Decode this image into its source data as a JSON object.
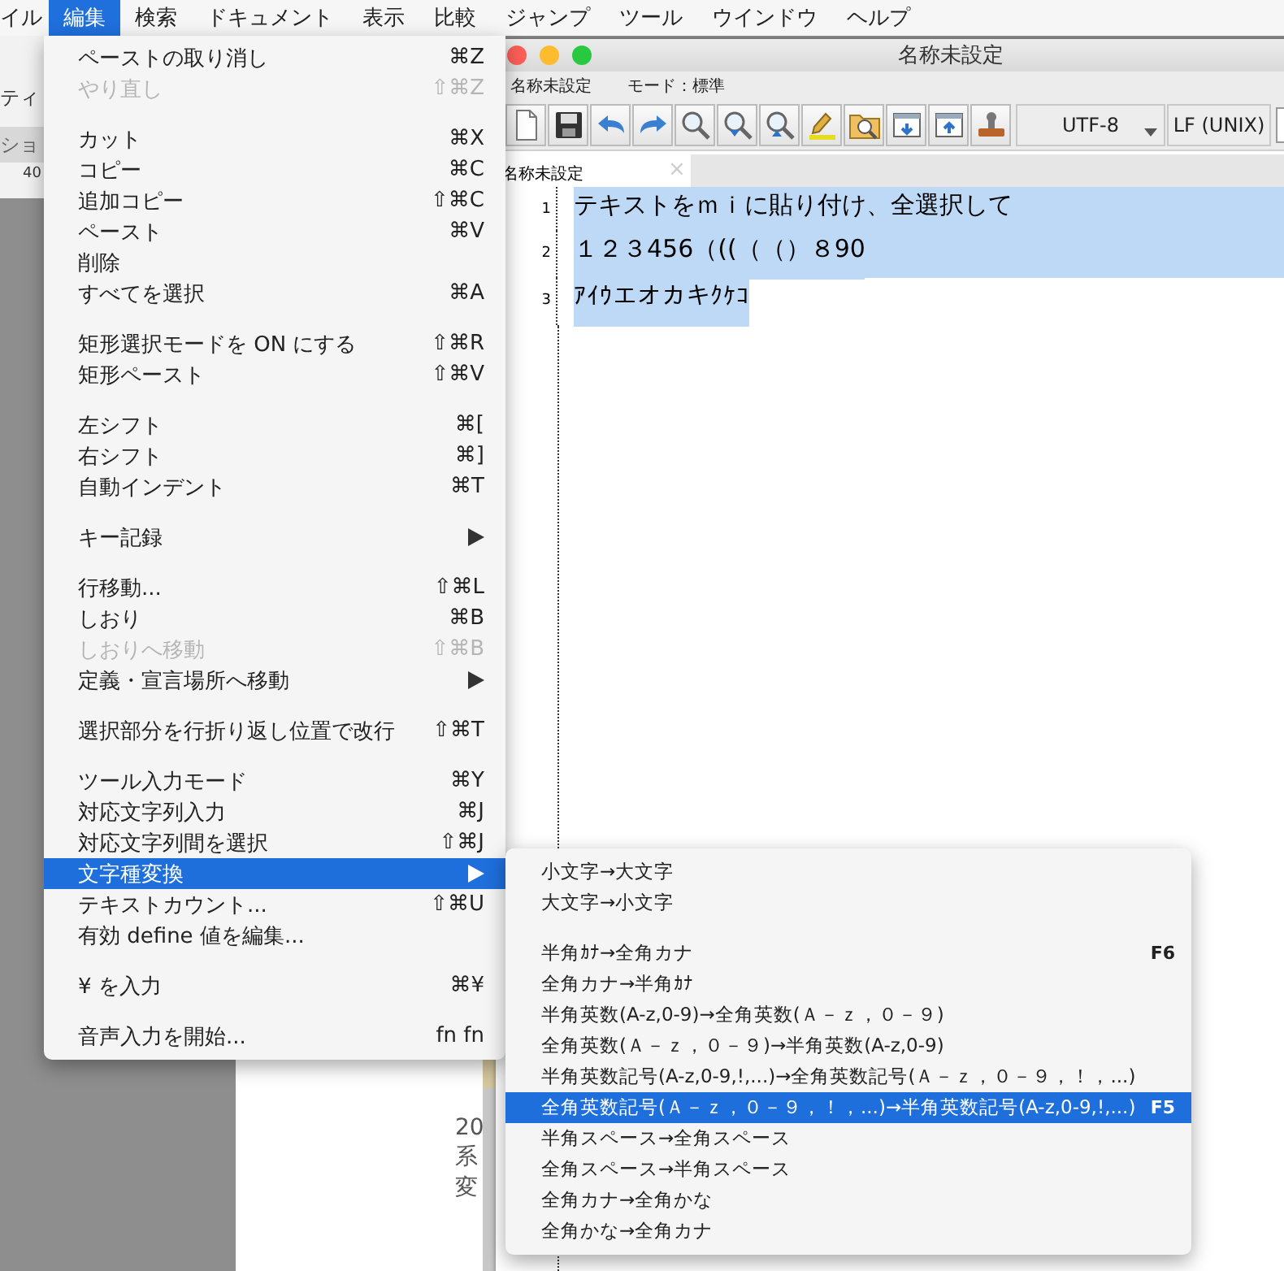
{
  "menubar": {
    "items": [
      {
        "label": "イル",
        "selected": false
      },
      {
        "label": "編集",
        "selected": true
      },
      {
        "label": "検索",
        "selected": false
      },
      {
        "label": "ドキュメント",
        "selected": false
      },
      {
        "label": "表示",
        "selected": false
      },
      {
        "label": "比較",
        "selected": false
      },
      {
        "label": "ジャンプ",
        "selected": false
      },
      {
        "label": "ツール",
        "selected": false
      },
      {
        "label": "ウインドウ",
        "selected": false
      },
      {
        "label": "ヘルプ",
        "selected": false
      }
    ]
  },
  "background_windows": {
    "left_texts": [
      "ティ",
      "ショ",
      "40"
    ],
    "middle_texts": [
      "20",
      "系",
      "変"
    ]
  },
  "editor_window": {
    "title": "名称未設定",
    "document_name": "名称未設定",
    "mode": "モード：標準",
    "encoding": "UTF-8",
    "line_ending": "LF (UNIX)",
    "tab": {
      "label": "名称未設定",
      "close": "×",
      "selected": true
    },
    "lines": [
      {
        "number": "1",
        "text": "テキストをｍｉに貼り付け、全選択して",
        "selected": true,
        "newline_selected": true
      },
      {
        "number": "2",
        "text": "１２３456（((（（）８90",
        "selected": true,
        "newline_selected": true
      },
      {
        "number": "3",
        "text": "ｱｲｳエオカキｸｹｺ",
        "selected": true,
        "newline_selected": false
      }
    ]
  },
  "edit_menu": {
    "items": [
      {
        "kind": "item",
        "label": "ペーストの取り消し",
        "shortcut": "⌘Z",
        "disabled": false,
        "selected": false,
        "submenu": false
      },
      {
        "kind": "item",
        "label": "やり直し",
        "shortcut": "⇧⌘Z",
        "disabled": true,
        "selected": false,
        "submenu": false
      },
      {
        "kind": "separator"
      },
      {
        "kind": "item",
        "label": "カット",
        "shortcut": "⌘X",
        "disabled": false,
        "selected": false,
        "submenu": false
      },
      {
        "kind": "item",
        "label": "コピー",
        "shortcut": "⌘C",
        "disabled": false,
        "selected": false,
        "submenu": false
      },
      {
        "kind": "item",
        "label": "追加コピー",
        "shortcut": "⇧⌘C",
        "disabled": false,
        "selected": false,
        "submenu": false
      },
      {
        "kind": "item",
        "label": "ペースト",
        "shortcut": "⌘V",
        "disabled": false,
        "selected": false,
        "submenu": false
      },
      {
        "kind": "item",
        "label": "削除",
        "disabled": false,
        "selected": false,
        "submenu": false
      },
      {
        "kind": "item",
        "label": "すべてを選択",
        "shortcut": "⌘A",
        "disabled": false,
        "selected": false,
        "submenu": false
      },
      {
        "kind": "separator"
      },
      {
        "kind": "item",
        "label": "矩形選択モードを ON にする",
        "shortcut": "⇧⌘R",
        "disabled": false,
        "selected": false,
        "submenu": false
      },
      {
        "kind": "item",
        "label": "矩形ペースト",
        "shortcut": "⇧⌘V",
        "disabled": false,
        "selected": false,
        "submenu": false
      },
      {
        "kind": "separator"
      },
      {
        "kind": "item",
        "label": "左シフト",
        "shortcut": "⌘[",
        "disabled": false,
        "selected": false,
        "submenu": false
      },
      {
        "kind": "item",
        "label": "右シフト",
        "shortcut": "⌘]",
        "disabled": false,
        "selected": false,
        "submenu": false
      },
      {
        "kind": "item",
        "label": "自動インデント",
        "shortcut": "⌘T",
        "disabled": false,
        "selected": false,
        "submenu": false
      },
      {
        "kind": "separator"
      },
      {
        "kind": "item",
        "label": "キー記録",
        "disabled": false,
        "selected": false,
        "submenu": true
      },
      {
        "kind": "separator"
      },
      {
        "kind": "item",
        "label": "行移動...",
        "shortcut": "⇧⌘L",
        "disabled": false,
        "selected": false,
        "submenu": false
      },
      {
        "kind": "item",
        "label": "しおり",
        "shortcut": "⌘B",
        "disabled": false,
        "selected": false,
        "submenu": false
      },
      {
        "kind": "item",
        "label": "しおりへ移動",
        "shortcut": "⇧⌘B",
        "disabled": true,
        "selected": false,
        "submenu": false
      },
      {
        "kind": "item",
        "label": "定義・宣言場所へ移動",
        "disabled": false,
        "selected": false,
        "submenu": true
      },
      {
        "kind": "separator"
      },
      {
        "kind": "item",
        "label": "選択部分を行折り返し位置で改行",
        "shortcut": "⇧⌘T",
        "disabled": false,
        "selected": false,
        "submenu": false
      },
      {
        "kind": "separator"
      },
      {
        "kind": "item",
        "label": "ツール入力モード",
        "shortcut": "⌘Y",
        "disabled": false,
        "selected": false,
        "submenu": false
      },
      {
        "kind": "item",
        "label": "対応文字列入力",
        "shortcut": "⌘J",
        "disabled": false,
        "selected": false,
        "submenu": false
      },
      {
        "kind": "item",
        "label": "対応文字列間を選択",
        "shortcut": "⇧⌘J",
        "disabled": false,
        "selected": false,
        "submenu": false
      },
      {
        "kind": "item",
        "label": "文字種変換",
        "disabled": false,
        "selected": true,
        "submenu": true
      },
      {
        "kind": "item",
        "label": "テキストカウント...",
        "shortcut": "⇧⌘U",
        "disabled": false,
        "selected": false,
        "submenu": false
      },
      {
        "kind": "item",
        "label": "有効 define 値を編集...",
        "disabled": false,
        "selected": false,
        "submenu": false
      },
      {
        "kind": "separator"
      },
      {
        "kind": "item",
        "label": "¥ を入力",
        "shortcut": "⌘¥",
        "disabled": false,
        "selected": false,
        "submenu": false
      },
      {
        "kind": "separator"
      },
      {
        "kind": "item",
        "label": "音声入力を開始...",
        "shortcut": "fn fn",
        "disabled": false,
        "selected": false,
        "submenu": false
      }
    ]
  },
  "conversion_submenu": {
    "items": [
      {
        "kind": "item",
        "label": "小文字→大文字",
        "selected": false
      },
      {
        "kind": "item",
        "label": "大文字→小文字",
        "selected": false
      },
      {
        "kind": "separator"
      },
      {
        "kind": "item",
        "label": "半角ｶﾅ→全角カナ",
        "shortcut": "F6",
        "selected": false
      },
      {
        "kind": "item",
        "label": "全角カナ→半角ｶﾅ",
        "selected": false
      },
      {
        "kind": "item",
        "label": "半角英数(A-z,0-9)→全角英数(Ａ－ｚ，０－９)",
        "selected": false
      },
      {
        "kind": "item",
        "label": "全角英数(Ａ－ｚ，０－９)→半角英数(A-z,0-9)",
        "selected": false
      },
      {
        "kind": "item",
        "label": "半角英数記号(A-z,0-9,!,...)→全角英数記号(Ａ－ｚ，０－９，！，...)",
        "selected": false
      },
      {
        "kind": "item",
        "label": "全角英数記号(Ａ－ｚ，０－９，！，...)→半角英数記号(A-z,0-9,!,...)",
        "shortcut": "F5",
        "selected": true
      },
      {
        "kind": "item",
        "label": "半角スペース→全角スペース",
        "selected": false
      },
      {
        "kind": "item",
        "label": "全角スペース→半角スペース",
        "selected": false
      },
      {
        "kind": "item",
        "label": "全角カナ→全角かな",
        "selected": false
      },
      {
        "kind": "item",
        "label": "全角かな→全角カナ",
        "selected": false
      }
    ]
  }
}
